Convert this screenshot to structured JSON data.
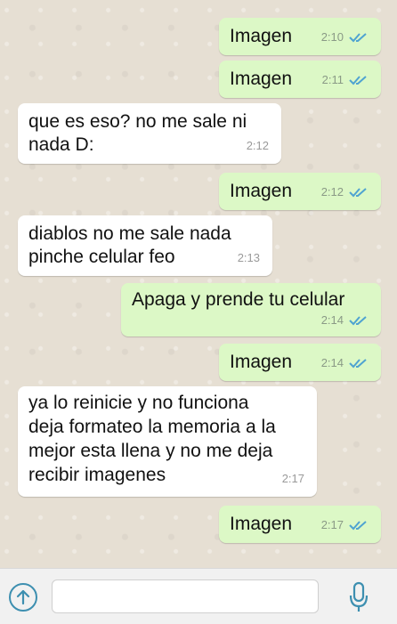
{
  "messages": [
    {
      "direction": "out",
      "text": "Imagen",
      "time": "2:10",
      "status_icon": "double-check-icon"
    },
    {
      "direction": "out",
      "text": "Imagen",
      "time": "2:11",
      "status_icon": "double-check-icon"
    },
    {
      "direction": "in",
      "lines": [
        "que es eso? no me sale ni",
        "nada D:"
      ],
      "time": "2:12"
    },
    {
      "direction": "out",
      "text": "Imagen",
      "time": "2:12",
      "status_icon": "double-check-icon"
    },
    {
      "direction": "in",
      "lines": [
        "diablos no me sale nada",
        "pinche celular feo"
      ],
      "time": "2:13"
    },
    {
      "direction": "out",
      "text": "Apaga y prende tu celular",
      "time": "2:14",
      "status_icon": "double-check-icon"
    },
    {
      "direction": "out",
      "text": "Imagen",
      "time": "2:14",
      "status_icon": "double-check-icon"
    },
    {
      "direction": "in",
      "lines": [
        "ya lo reinicie y no funciona",
        "deja formateo la memoria a la",
        "mejor esta llena y no me deja",
        "recibir imagenes"
      ],
      "time": "2:17"
    },
    {
      "direction": "out",
      "text": "Imagen",
      "time": "2:17",
      "status_icon": "double-check-icon"
    }
  ],
  "composer": {
    "placeholder": "",
    "attach_icon": "upload-arrow-icon",
    "mic_icon": "microphone-icon"
  },
  "colors": {
    "outgoing_bubble": "#dcf8c6",
    "incoming_bubble": "#ffffff",
    "tick_blue": "#4fa3d1"
  }
}
